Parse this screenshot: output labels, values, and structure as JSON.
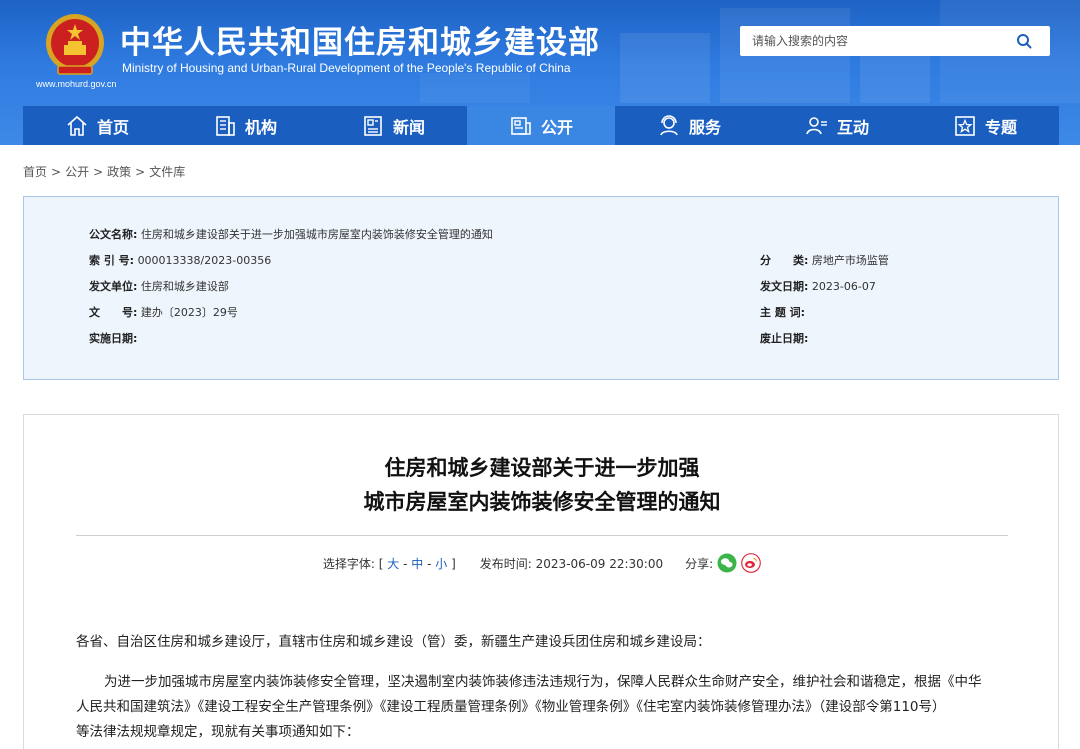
{
  "header": {
    "title_cn": "中华人民共和国住房和城乡建设部",
    "title_en": "Ministry of Housing and Urban-Rural Development of the People's Republic of China",
    "url": "www.mohurd.gov.cn",
    "search_placeholder": "请输入搜索的内容",
    "colors": {
      "header_bg": "#2f7be0",
      "nav_bg": "#1a5fbf",
      "nav_active": "#3a86e3"
    }
  },
  "nav": [
    {
      "label": "首页",
      "icon": "home-icon"
    },
    {
      "label": "机构",
      "icon": "building-icon"
    },
    {
      "label": "新闻",
      "icon": "newspaper-icon"
    },
    {
      "label": "公开",
      "icon": "public-info-icon",
      "active": true
    },
    {
      "label": "服务",
      "icon": "service-person-icon"
    },
    {
      "label": "互动",
      "icon": "interact-person-icon"
    },
    {
      "label": "专题",
      "icon": "star-icon"
    }
  ],
  "breadcrumb": [
    "首页",
    "公开",
    "政策",
    "文件库"
  ],
  "meta": {
    "doc_name_label": "公文名称:",
    "doc_name": "住房和城乡建设部关于进一步加强城市房屋室内装饰装修安全管理的通知",
    "index_label": "索 引 号:",
    "index": "000013338/2023-00356",
    "category_label": "分　　类:",
    "category": "房地产市场监管",
    "issuer_label": "发文单位:",
    "issuer": "住房和城乡建设部",
    "issue_date_label": "发文日期:",
    "issue_date": "2023-06-07",
    "doc_no_label": "文　　号:",
    "doc_no": "建办〔2023〕29号",
    "keywords_label": "主 题 词:",
    "keywords": "",
    "effective_label": "实施日期:",
    "effective": "",
    "expiry_label": "废止日期:",
    "expiry": ""
  },
  "article": {
    "title_line1": "住房和城乡建设部关于进一步加强",
    "title_line2": "城市房屋室内装饰装修安全管理的通知",
    "font_select_label": "选择字体:",
    "font_bracket_open": "[",
    "font_large": "大",
    "font_medium": "中",
    "font_small": "小",
    "font_bracket_close": "]",
    "publish_label": "发布时间:",
    "publish_time": "2023-06-09 22:30:00",
    "share_label": "分享:",
    "para1": "各省、自治区住房和城乡建设厅，直辖市住房和城乡建设（管）委，新疆生产建设兵团住房和城乡建设局：",
    "para2_line1": "为进一步加强城市房屋室内装饰装修安全管理，坚决遏制室内装饰装修违法违规行为，保障人民群众生命财产安全，维护社会和谐稳定，根据《中华",
    "para2_line2": "人民共和国建筑法》《建设工程安全生产管理条例》《建设工程质量管理条例》《物业管理条例》《住宅室内装饰装修管理办法》（建设部令第110号）",
    "para2_line3": "等法律法规规章规定，现就有关事项通知如下："
  }
}
